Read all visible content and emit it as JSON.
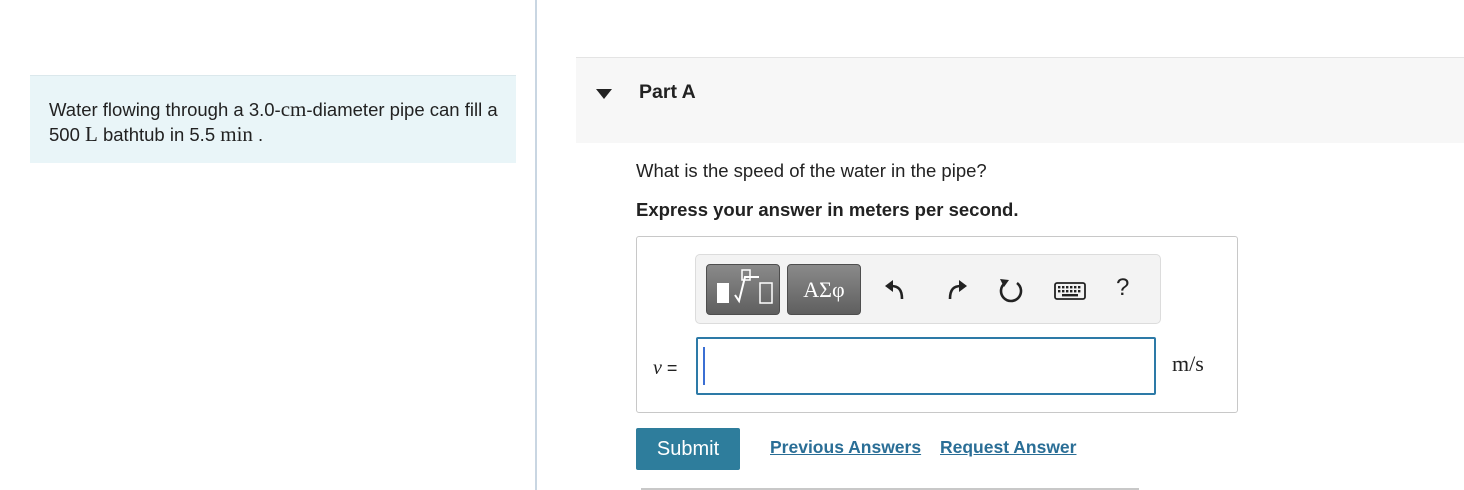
{
  "problem": {
    "text_part1": "Water flowing through a 3.0-",
    "unit_cm": "cm",
    "text_part2": "-diameter pipe can fill a 500 ",
    "unit_L": "L",
    "text_part3": " bathtub in 5.5 ",
    "unit_min": "min",
    "text_part4": " ."
  },
  "part": {
    "title": "Part A"
  },
  "question": {
    "text": "What is the speed of the water in the pipe?",
    "instruction": "Express your answer in meters per second."
  },
  "toolbar": {
    "templates_icon": "templates-icon",
    "symbols_label": "ΑΣφ",
    "undo_icon": "undo-icon",
    "redo_icon": "redo-icon",
    "reset_icon": "reset-icon",
    "keyboard_icon": "keyboard-icon",
    "help_label": "?"
  },
  "answer": {
    "variable": "v",
    "equals": "=",
    "value": "",
    "unit": "m/s"
  },
  "actions": {
    "submit_label": "Submit",
    "previous_answers_label": "Previous Answers",
    "request_answer_label": "Request Answer"
  },
  "colors": {
    "problem_bg": "#e9f5f8",
    "submit_bg": "#2e7d9c",
    "link": "#2a6e96",
    "input_border": "#2d7aa7"
  }
}
